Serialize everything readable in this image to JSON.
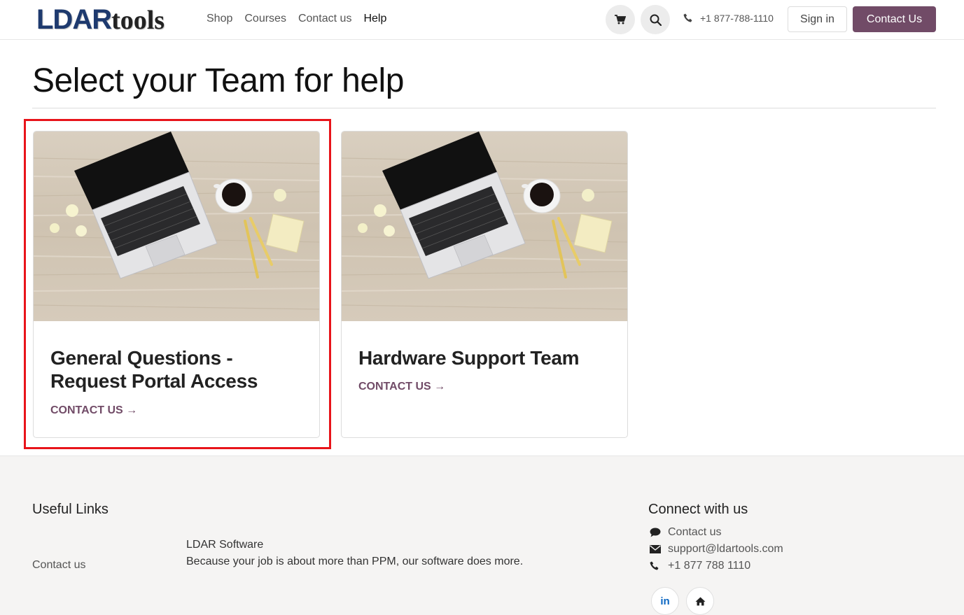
{
  "header": {
    "logo_main": "LDAR",
    "logo_tail": "tools",
    "nav": [
      "Shop",
      "Courses",
      "Contact us",
      "Help"
    ],
    "phone": "+1 877-788-1110",
    "signin_label": "Sign in",
    "contact_label": "Contact Us"
  },
  "page": {
    "title": "Select your Team for help"
  },
  "cards": [
    {
      "title": "General Questions - Request Portal Access",
      "link": "CONTACT US →"
    },
    {
      "title": "Hardware Support Team",
      "link": "CONTACT US →"
    }
  ],
  "footer": {
    "useful_heading": "Useful Links",
    "useful_link": "Contact us",
    "company_name": "LDAR Software",
    "company_tagline": "Because your job is about more than PPM, our software does more.",
    "connect_heading": "Connect with us",
    "connect_contact": "Contact us",
    "connect_email": "support@ldartools.com",
    "connect_phone": "+1 877 788 1110",
    "social_linkedin": "in"
  },
  "colors": {
    "brand": "#714b67",
    "highlight": "#e8141a",
    "logo_blue": "#1e3a6e"
  }
}
